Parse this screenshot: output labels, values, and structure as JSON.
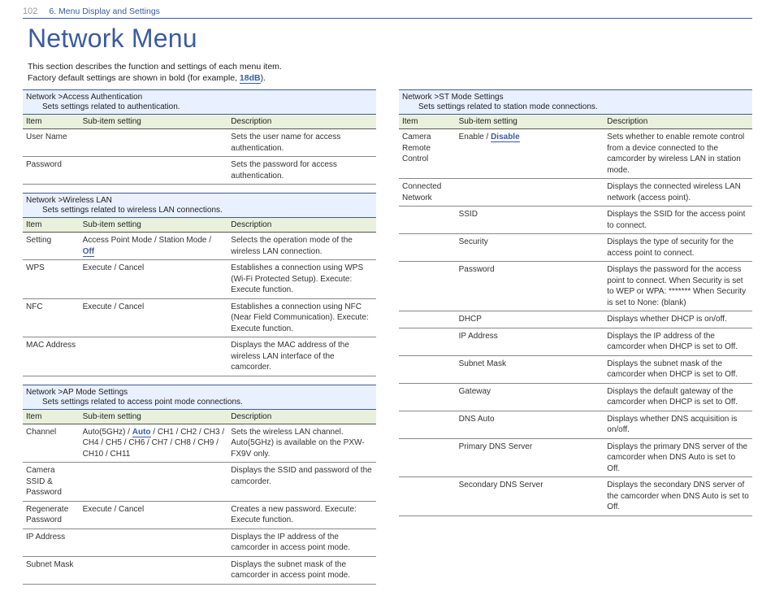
{
  "header": {
    "page_number": "102",
    "section": "6. Menu Display and Settings"
  },
  "title": "Network Menu",
  "intro_line1": "This section describes the function and settings of each menu item.",
  "intro_line2_prefix": "Factory default settings are shown in bold (for example, ",
  "intro_example": "18dB",
  "intro_line2_suffix": ").",
  "col_headers": {
    "item": "Item",
    "sub": "Sub-item setting",
    "desc": "Description"
  },
  "groups": {
    "access_auth": {
      "title": "Network >Access Authentication",
      "desc": "Sets settings related to authentication."
    },
    "wlan": {
      "title": "Network >Wireless LAN",
      "desc": "Sets settings related to wireless LAN connections."
    },
    "ap": {
      "title": "Network >AP Mode Settings",
      "desc": "Sets settings related to access point mode connections."
    },
    "st": {
      "title": "Network >ST Mode Settings",
      "desc": "Sets settings related to station mode connections."
    }
  },
  "rows": {
    "user_name": {
      "item": "User Name",
      "sub": "",
      "desc": "Sets the user name for access authentication."
    },
    "password": {
      "item": "Password",
      "sub": "",
      "desc": "Sets the password for access authentication."
    },
    "setting": {
      "item": "Setting",
      "sub_prefix": "Access Point Mode / Station Mode / ",
      "sub_default": "Off",
      "desc": "Selects the operation mode of the wireless LAN connection."
    },
    "wps": {
      "item": "WPS",
      "sub": "Execute / Cancel",
      "desc": "Establishes a connection using WPS (Wi-Fi Protected Setup).\nExecute: Execute function."
    },
    "nfc": {
      "item": "NFC",
      "sub": "Execute / Cancel",
      "desc": "Establishes a connection using NFC (Near Field Communication).\nExecute: Execute function."
    },
    "mac": {
      "item": "MAC Address",
      "sub": "",
      "desc": "Displays the MAC address of the wireless LAN interface of the camcorder."
    },
    "channel": {
      "item": "Channel",
      "sub_pre": "Auto(5GHz) / ",
      "sub_default": "Auto",
      "sub_post": " / CH1 / CH2 / CH3 / CH4 / CH5 / CH6 / CH7 / CH8 / CH9 / CH10 / CH11",
      "desc": "Sets the wireless LAN channel.\nAuto(5GHz) is available on the PXW-FX9V only."
    },
    "cam_ssid": {
      "item": "Camera SSID & Password",
      "sub": "",
      "desc": "Displays the SSID and password of the camcorder."
    },
    "regen": {
      "item": "Regenerate Password",
      "sub": "Execute / Cancel",
      "desc": "Creates a new password.\nExecute: Execute function."
    },
    "ip_ap": {
      "item": "IP Address",
      "sub": "",
      "desc": "Displays the IP address of the camcorder in access point mode."
    },
    "subnet_ap": {
      "item": "Subnet Mask",
      "sub": "",
      "desc": "Displays the subnet mask of the camcorder in access point mode."
    },
    "crc": {
      "item": "Camera Remote Control",
      "sub_pre": "Enable / ",
      "sub_default": "Disable",
      "desc": "Sets whether to enable remote control from a device connected to the camcorder by wireless LAN in station mode."
    },
    "conn_net": {
      "item": "Connected Network",
      "sub": "",
      "desc": "Displays the connected wireless LAN network (access point)."
    },
    "ssid": {
      "item": "",
      "sub": "SSID",
      "desc": "Displays the SSID for the access point to connect."
    },
    "security": {
      "item": "",
      "sub": "Security",
      "desc": "Displays the type of security for the access point to connect."
    },
    "pw_st": {
      "item": "",
      "sub": "Password",
      "desc": "Displays the password for the access point to connect.\nWhen Security is set to WEP or WPA: *******\nWhen Security is set to None: (blank)"
    },
    "dhcp": {
      "item": "",
      "sub": "DHCP",
      "desc": "Displays whether DHCP is on/off."
    },
    "ip_st": {
      "item": "",
      "sub": "IP Address",
      "desc": "Displays the IP address of the camcorder when DHCP is set to Off."
    },
    "subnet_st": {
      "item": "",
      "sub": "Subnet Mask",
      "desc": "Displays the subnet mask of the camcorder when DHCP is set to Off."
    },
    "gateway": {
      "item": "",
      "sub": "Gateway",
      "desc": "Displays the default gateway of the camcorder when DHCP is set to Off."
    },
    "dns_auto": {
      "item": "",
      "sub": "DNS Auto",
      "desc": "Displays whether DNS acquisition is on/off."
    },
    "pdns": {
      "item": "",
      "sub": "Primary DNS Server",
      "desc": "Displays the primary DNS server of the camcorder when DNS Auto is set to Off."
    },
    "sdns": {
      "item": "",
      "sub": "Secondary DNS Server",
      "desc": "Displays the secondary DNS server of the camcorder when DNS Auto is set to Off."
    }
  }
}
